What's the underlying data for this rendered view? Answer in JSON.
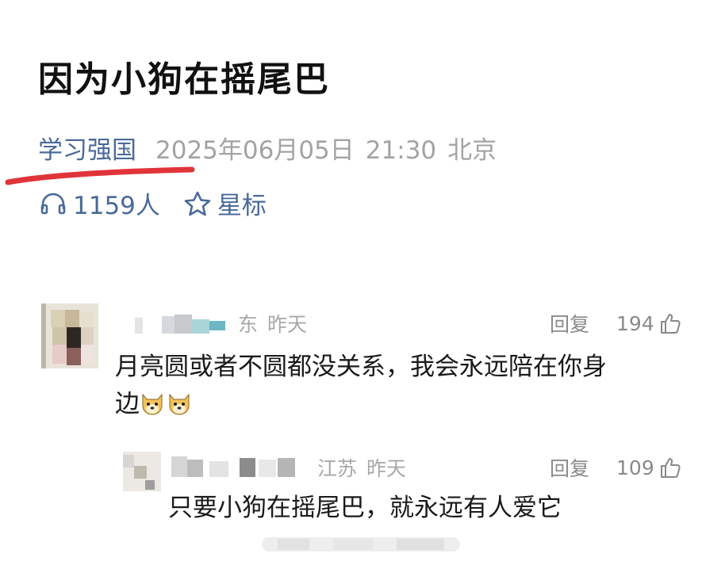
{
  "article": {
    "title": "因为小狗在摇尾巴",
    "source": "学习强国",
    "date": "2025年06月05日",
    "time": "21:30",
    "location": "北京",
    "listen_count": "1159人",
    "star_label": "星标"
  },
  "comments": [
    {
      "location_fragment": "东",
      "time": "昨天",
      "reply_label": "回复",
      "likes": "194",
      "text_line1": "月亮圆或者不圆都没关系，我会永远陪在你身",
      "text_line2": "边"
    },
    {
      "location": "江苏",
      "time": "昨天",
      "reply_label": "回复",
      "likes": "109",
      "text": "只要小狗在摇尾巴，就永远有人爱它"
    }
  ],
  "icons": {
    "listen": "headphones-icon",
    "star": "star-outline-icon",
    "like": "thumbs-up-icon",
    "emoji": "doge-emoji-icon"
  },
  "colors": {
    "source_link": "#4a6a9a",
    "meta_gray": "#a3a3a3",
    "underline_red": "#e0343a"
  }
}
